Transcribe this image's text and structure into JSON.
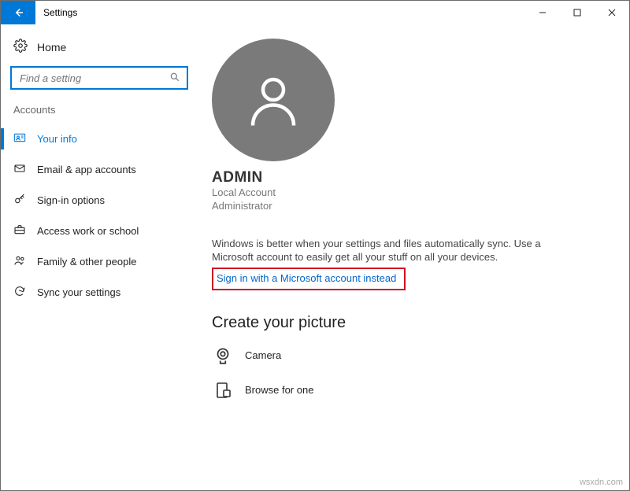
{
  "window": {
    "title": "Settings"
  },
  "sidebar": {
    "home_label": "Home",
    "search_placeholder": "Find a setting",
    "section_label": "Accounts",
    "items": [
      {
        "label": "Your info",
        "active": true
      },
      {
        "label": "Email & app accounts"
      },
      {
        "label": "Sign-in options"
      },
      {
        "label": "Access work or school"
      },
      {
        "label": "Family & other people"
      },
      {
        "label": "Sync your settings"
      }
    ]
  },
  "user": {
    "name": "ADMIN",
    "account_type": "Local Account",
    "role": "Administrator"
  },
  "pitch": {
    "text": "Windows is better when your settings and files automatically sync. Use a Microsoft account to easily get all your stuff on all your devices.",
    "link_label": "Sign in with a Microsoft account instead"
  },
  "picture": {
    "heading": "Create your picture",
    "camera_label": "Camera",
    "browse_label": "Browse for one"
  },
  "watermark": "wsxdn.com"
}
